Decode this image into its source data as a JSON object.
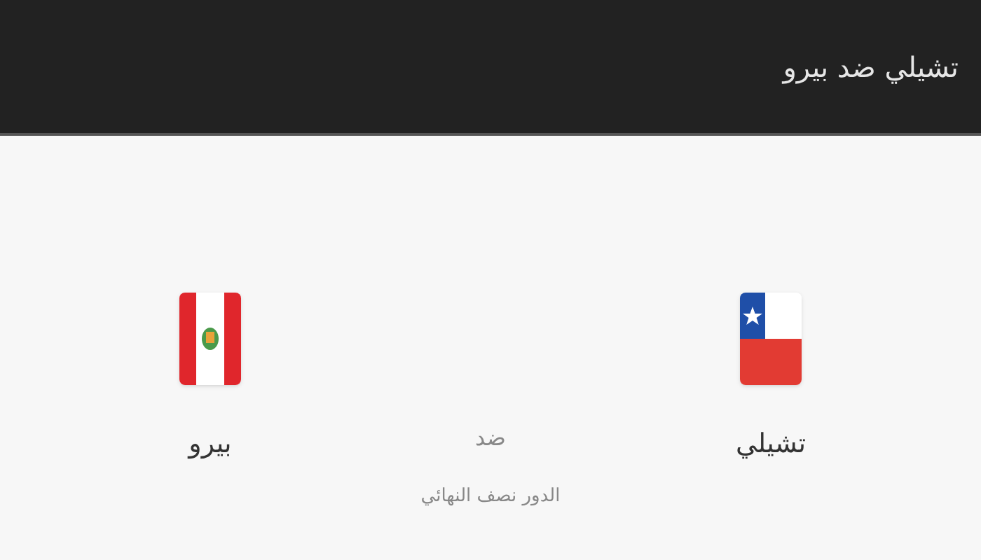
{
  "header": {
    "title": "تشيلي ضد بيرو"
  },
  "match": {
    "home": {
      "name": "تشيلي",
      "kind": "chile"
    },
    "away": {
      "name": "بيرو",
      "kind": "peru"
    },
    "versus": "ضد",
    "round": "الدور نصف النهائي"
  }
}
